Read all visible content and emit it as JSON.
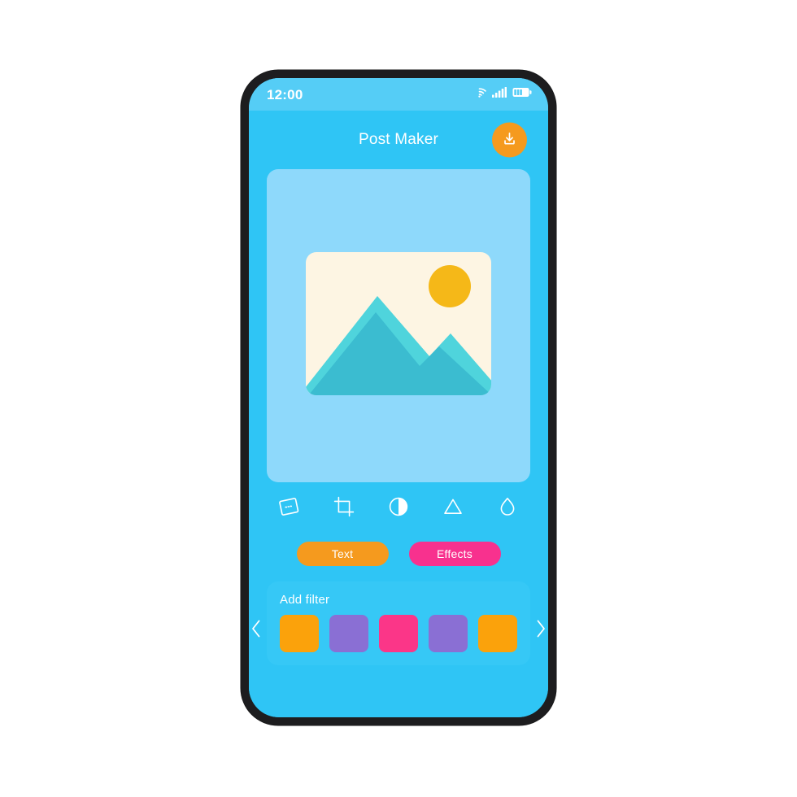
{
  "status_bar": {
    "time": "12:00",
    "icons": [
      "wifi-icon",
      "cellular-signal-icon",
      "battery-icon"
    ]
  },
  "header": {
    "title": "Post Maker",
    "download_button": {
      "icon": "download-icon",
      "label": "Download",
      "color": "#f59a1e"
    }
  },
  "preview": {
    "card_color": "#8ed9fb",
    "placeholder_icon": "image-placeholder-icon",
    "photo": {
      "background": "#fdf5e3",
      "sun_color": "#f5b818",
      "mountain_back_color": "#4fd4dc",
      "mountain_front_color": "#3bbcd0"
    }
  },
  "tools": [
    {
      "name": "perspective-icon",
      "label": "Perspective"
    },
    {
      "name": "crop-icon",
      "label": "Crop"
    },
    {
      "name": "contrast-icon",
      "label": "Contrast"
    },
    {
      "name": "sharpen-icon",
      "label": "Sharpen"
    },
    {
      "name": "saturation-icon",
      "label": "Saturation"
    }
  ],
  "actions": [
    {
      "label": "Text",
      "color": "#f59a1e"
    },
    {
      "label": "Effects",
      "color": "#f8318e"
    }
  ],
  "filters": {
    "title": "Add filter",
    "panel_color": "#36c8f6",
    "prev_icon": "chevron-left-icon",
    "next_icon": "chevron-right-icon",
    "swatches": [
      {
        "color": "#fba20b"
      },
      {
        "color": "#8a6fd4"
      },
      {
        "color": "#fb3688"
      },
      {
        "color": "#8a6fd4"
      },
      {
        "color": "#fba20b"
      }
    ]
  },
  "theme": {
    "page_background": "#ffffff",
    "frame_color": "#1d1d1f",
    "screen_background": "#2fc5f5",
    "status_bar_background": "#55cdf6",
    "text_on_blue": "#ffffff"
  }
}
